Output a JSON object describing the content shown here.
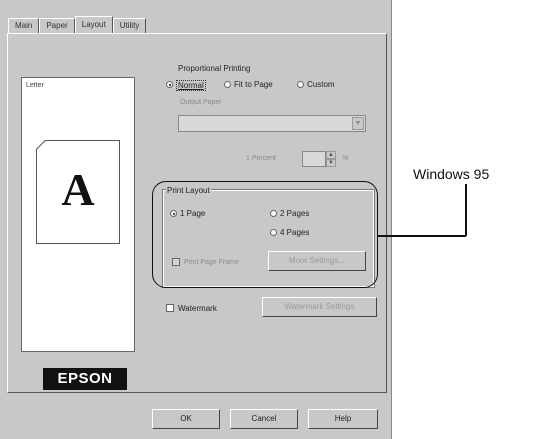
{
  "tabs": [
    {
      "label": "Main"
    },
    {
      "label": "Paper"
    },
    {
      "label": "Layout"
    },
    {
      "label": "Utility"
    }
  ],
  "preview": {
    "paper_size": "Letter",
    "page_letter": "A"
  },
  "proportional": {
    "heading": "Proportional Printing",
    "normal": "Normal",
    "fit_to_page": "Fit to Page",
    "custom": "Custom",
    "output_paper": "Output Paper",
    "combo_value": "",
    "scale_label": "1 Percent",
    "scale_value": "",
    "percent_sign": "%"
  },
  "print_layout": {
    "heading": "Print Layout",
    "one_page": "1 Page",
    "two_pages": "2 Pages",
    "four_pages": "4 Pages",
    "print_borders": "Print Page Frame",
    "more_settings": "More Settings..."
  },
  "watermark": {
    "label": "Watermark",
    "settings_button": "Watermark Settings"
  },
  "logo": {
    "text": "EPSON"
  },
  "footer": {
    "ok": "OK",
    "cancel": "Cancel",
    "help": "Help"
  },
  "annotation": {
    "label": "Windows 95"
  }
}
